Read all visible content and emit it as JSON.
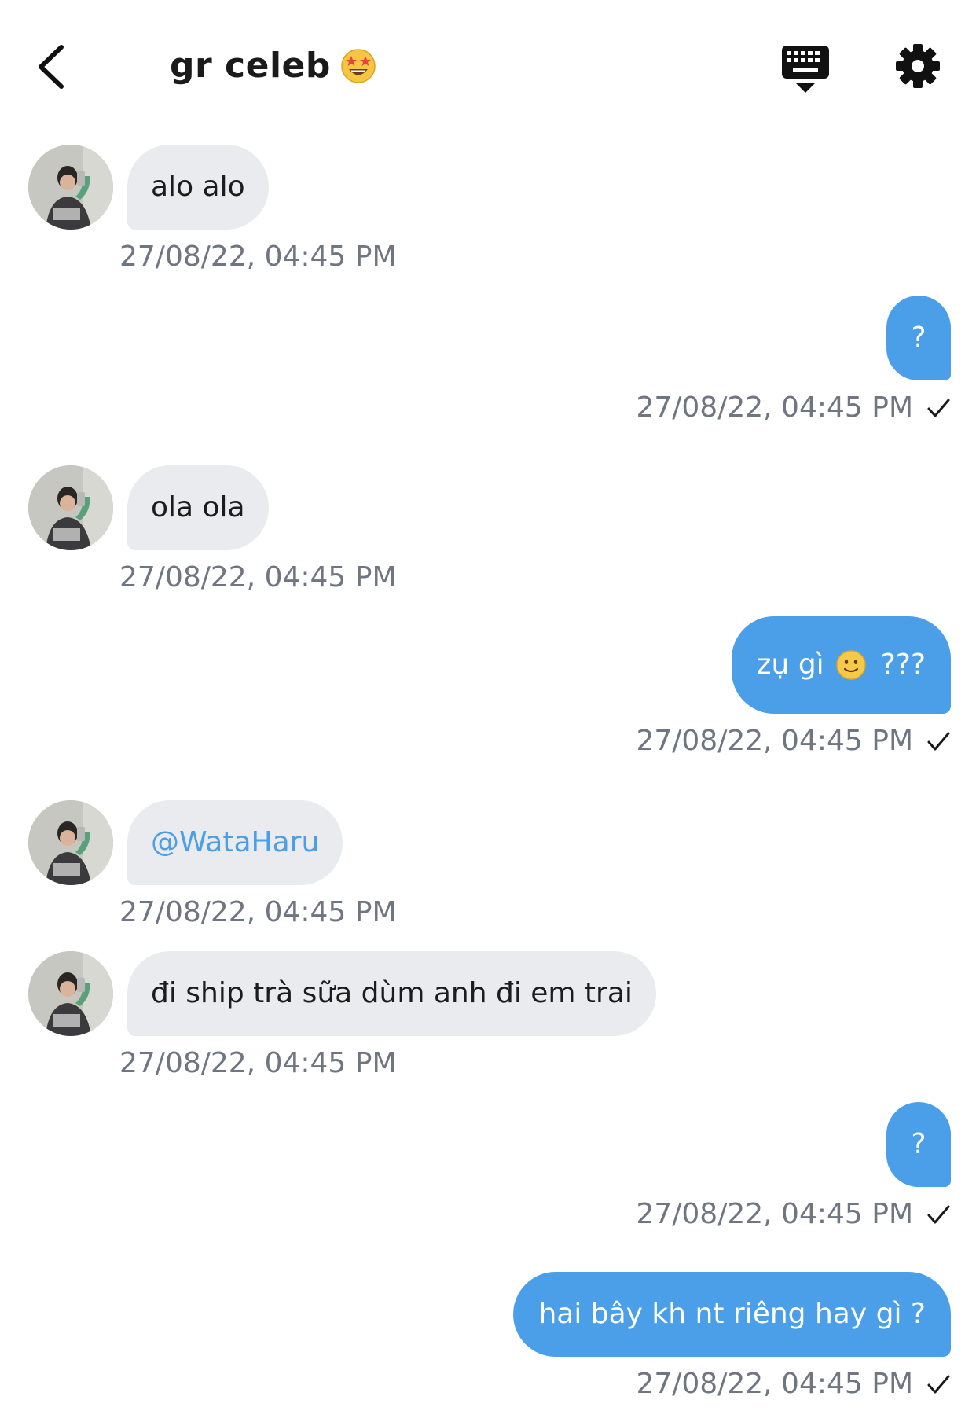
{
  "header": {
    "title": "gr celeb",
    "title_emoji": "star-struck-emoji"
  },
  "icons": {
    "back": "chevron-left-icon",
    "keyboard": "keyboard-hide-icon",
    "settings": "gear-icon"
  },
  "colors": {
    "outgoing_bubble": "#4a9fe8",
    "incoming_bubble": "#e9ebee",
    "timestamp": "#6f7682",
    "mention": "#4a9fe8"
  },
  "messages": [
    {
      "direction": "in",
      "text": "alo alo",
      "time": "27/08/22, 04:45 PM"
    },
    {
      "direction": "out",
      "text": "?",
      "time": "27/08/22, 04:45 PM",
      "status": "sent"
    },
    {
      "direction": "in",
      "text": "ola ola",
      "time": "27/08/22, 04:45 PM"
    },
    {
      "direction": "out",
      "text_before": "zụ gì",
      "emoji": "slightly-smiling-face-emoji",
      "text_after": "???",
      "time": "27/08/22, 04:45 PM",
      "status": "sent"
    },
    {
      "direction": "in",
      "text": "@WataHaru",
      "is_mention": true,
      "time": "27/08/22, 04:45 PM"
    },
    {
      "direction": "in",
      "text": "đi ship trà sữa dùm anh đi em trai",
      "time": "27/08/22, 04:45 PM"
    },
    {
      "direction": "out",
      "text": "?",
      "time": "27/08/22, 04:45 PM",
      "status": "sent"
    },
    {
      "direction": "out",
      "text": "hai bây kh nt riêng hay gì ?",
      "time": "27/08/22, 04:45 PM",
      "status": "sent"
    }
  ]
}
